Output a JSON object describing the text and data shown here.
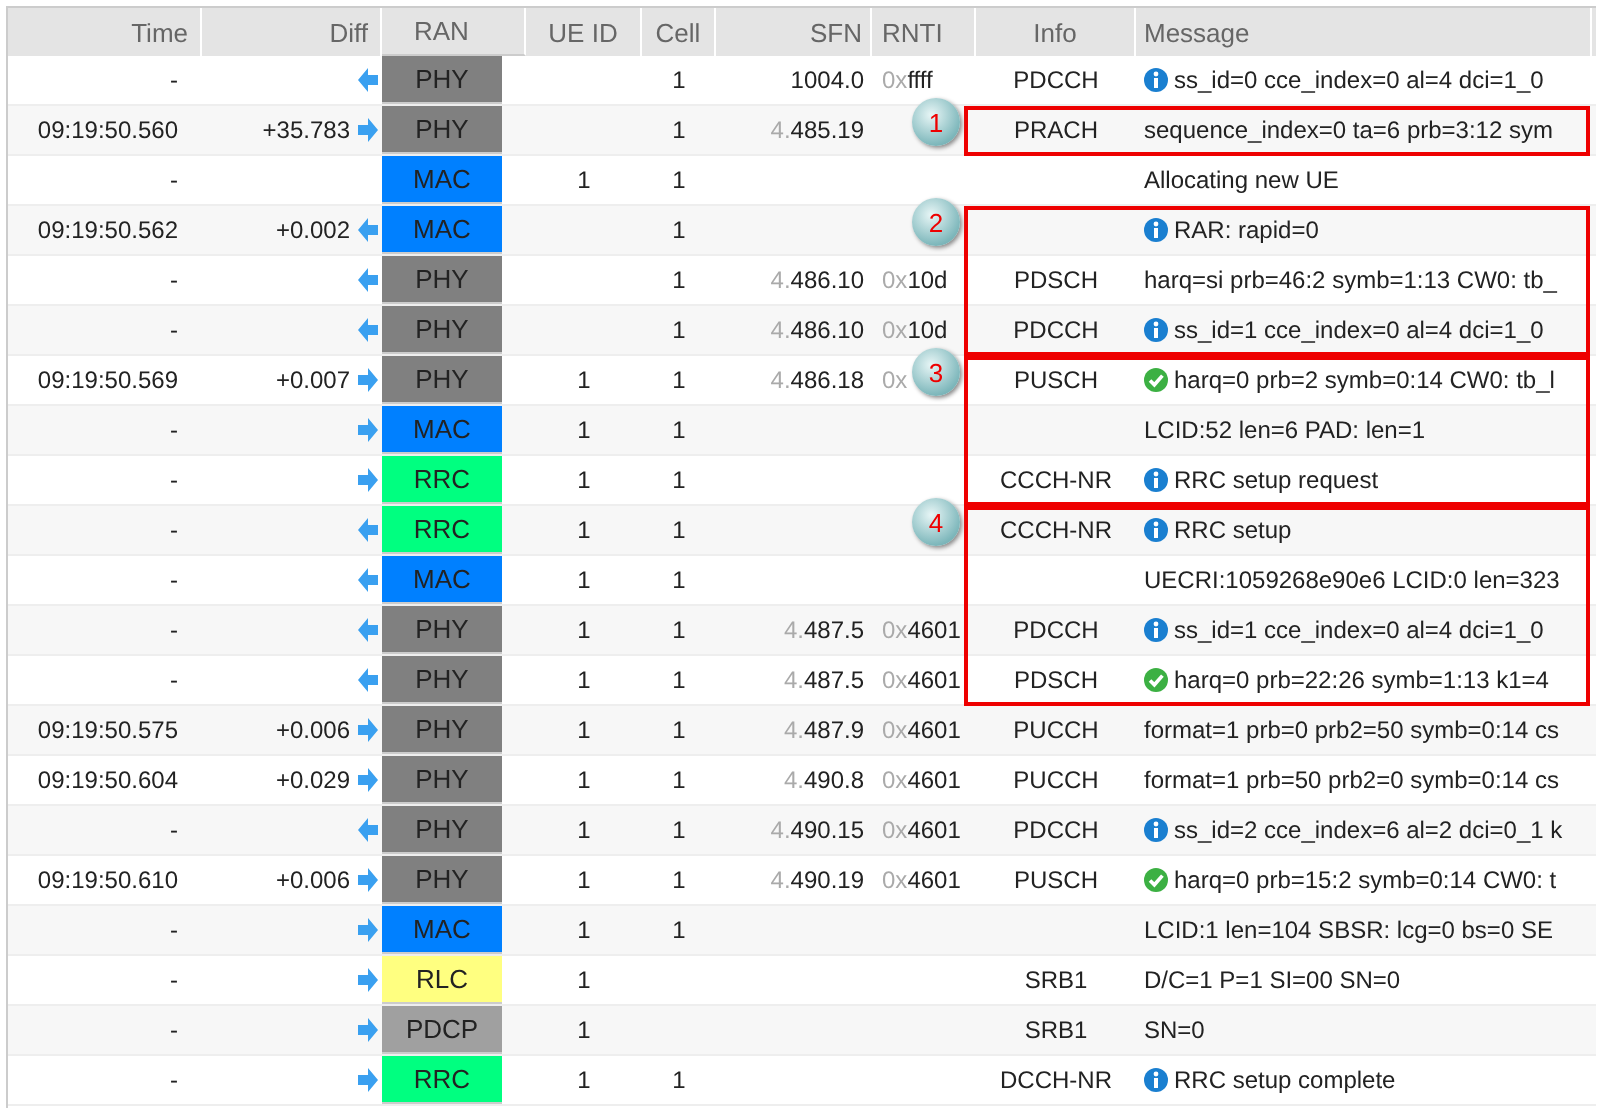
{
  "columns": [
    "Time",
    "Diff",
    "RAN",
    "UE ID",
    "Cell",
    "SFN",
    "RNTI",
    "Info",
    "Message"
  ],
  "rows": [
    {
      "time": "-",
      "diff": "",
      "arrow": true,
      "uplink": false,
      "ran": "PHY",
      "color": "#808080",
      "ue": "",
      "cell": "1",
      "sfn_prefix": "",
      "sfn": "1004.0",
      "rnti_prefix": "0x",
      "rnti": "ffff",
      "info": "PDCCH",
      "kind": "info",
      "message": "ss_id=0 cce_index=0 al=4 dci=1_0",
      "boxed": false
    },
    {
      "time": "09:19:50.560",
      "diff": "+35.783",
      "arrow": true,
      "uplink": true,
      "ran": "PHY",
      "color": "#808080",
      "ue": "",
      "cell": "1",
      "sfn_prefix": "4.",
      "sfn": "485.19",
      "rnti_prefix": "",
      "rnti": "",
      "info": "PRACH",
      "kind": "plain",
      "message": "sequence_index=0 ta=6 prb=3:12 sym",
      "boxed": true,
      "callout": "1"
    },
    {
      "time": "-",
      "diff": "",
      "arrow": false,
      "ran": "MAC",
      "color": "#0080ff",
      "ue": "1",
      "cell": "1",
      "sfn_prefix": "",
      "sfn": "",
      "rnti_prefix": "",
      "rnti": "",
      "info": "",
      "kind": "plain",
      "message": "Allocating new UE",
      "boxed": false
    },
    {
      "time": "09:19:50.562",
      "diff": "+0.002",
      "arrow": true,
      "uplink": false,
      "ran": "MAC",
      "color": "#0080ff",
      "ue": "",
      "cell": "1",
      "sfn_prefix": "",
      "sfn": "",
      "rnti_prefix": "",
      "rnti": "",
      "info": "",
      "kind": "info",
      "message": "RAR: rapid=0",
      "boxed": true,
      "callout": "2"
    },
    {
      "time": "-",
      "diff": "",
      "arrow": true,
      "uplink": false,
      "ran": "PHY",
      "color": "#808080",
      "ue": "",
      "cell": "1",
      "sfn_prefix": "4.",
      "sfn": "486.10",
      "rnti_prefix": "0x",
      "rnti": "10d",
      "info": "PDSCH",
      "kind": "plain",
      "message": "harq=si prb=46:2 symb=1:13 CW0: tb_",
      "boxed": true
    },
    {
      "time": "-",
      "diff": "",
      "arrow": true,
      "uplink": false,
      "ran": "PHY",
      "color": "#808080",
      "ue": "",
      "cell": "1",
      "sfn_prefix": "4.",
      "sfn": "486.10",
      "rnti_prefix": "0x",
      "rnti": "10d",
      "info": "PDCCH",
      "kind": "info",
      "message": "ss_id=1 cce_index=0 al=4 dci=1_0",
      "boxed": true
    },
    {
      "time": "09:19:50.569",
      "diff": "+0.007",
      "arrow": true,
      "uplink": true,
      "ran": "PHY",
      "color": "#808080",
      "ue": "1",
      "cell": "1",
      "sfn_prefix": "4.",
      "sfn": "486.18",
      "rnti_prefix": "0x",
      "rnti": "",
      "info": "PUSCH",
      "kind": "ok",
      "message": "harq=0 prb=2 symb=0:14 CW0: tb_l",
      "boxed": true,
      "callout": "3"
    },
    {
      "time": "-",
      "diff": "",
      "arrow": true,
      "uplink": true,
      "ran": "MAC",
      "color": "#0080ff",
      "ue": "1",
      "cell": "1",
      "sfn_prefix": "",
      "sfn": "",
      "rnti_prefix": "",
      "rnti": "",
      "info": "",
      "kind": "plain",
      "message": "LCID:52 len=6 PAD: len=1",
      "boxed": true
    },
    {
      "time": "-",
      "diff": "",
      "arrow": true,
      "uplink": true,
      "ran": "RRC",
      "color": "#00ff80",
      "ue": "1",
      "cell": "1",
      "sfn_prefix": "",
      "sfn": "",
      "rnti_prefix": "",
      "rnti": "",
      "info": "CCCH-NR",
      "kind": "info",
      "message": "RRC setup request",
      "boxed": true
    },
    {
      "time": "-",
      "diff": "",
      "arrow": true,
      "uplink": false,
      "ran": "RRC",
      "color": "#00ff80",
      "ue": "1",
      "cell": "1",
      "sfn_prefix": "",
      "sfn": "",
      "rnti_prefix": "",
      "rnti": "",
      "info": "CCCH-NR",
      "kind": "info",
      "message": "RRC setup",
      "boxed": true,
      "callout": "4"
    },
    {
      "time": "-",
      "diff": "",
      "arrow": true,
      "uplink": false,
      "ran": "MAC",
      "color": "#0080ff",
      "ue": "1",
      "cell": "1",
      "sfn_prefix": "",
      "sfn": "",
      "rnti_prefix": "",
      "rnti": "",
      "info": "",
      "kind": "plain",
      "message": "UECRI:1059268e90e6 LCID:0 len=323",
      "boxed": true
    },
    {
      "time": "-",
      "diff": "",
      "arrow": true,
      "uplink": false,
      "ran": "PHY",
      "color": "#808080",
      "ue": "1",
      "cell": "1",
      "sfn_prefix": "4.",
      "sfn": "487.5",
      "rnti_prefix": "0x",
      "rnti": "4601",
      "info": "PDCCH",
      "kind": "info",
      "message": "ss_id=1 cce_index=0 al=4 dci=1_0",
      "boxed": true
    },
    {
      "time": "-",
      "diff": "",
      "arrow": true,
      "uplink": false,
      "ran": "PHY",
      "color": "#808080",
      "ue": "1",
      "cell": "1",
      "sfn_prefix": "4.",
      "sfn": "487.5",
      "rnti_prefix": "0x",
      "rnti": "4601",
      "info": "PDSCH",
      "kind": "ok",
      "message": "harq=0 prb=22:26 symb=1:13 k1=4",
      "boxed": true
    },
    {
      "time": "09:19:50.575",
      "diff": "+0.006",
      "arrow": true,
      "uplink": true,
      "ran": "PHY",
      "color": "#808080",
      "ue": "1",
      "cell": "1",
      "sfn_prefix": "4.",
      "sfn": "487.9",
      "rnti_prefix": "0x",
      "rnti": "4601",
      "info": "PUCCH",
      "kind": "plain",
      "message": "format=1 prb=0 prb2=50 symb=0:14 cs",
      "boxed": false
    },
    {
      "time": "09:19:50.604",
      "diff": "+0.029",
      "arrow": true,
      "uplink": true,
      "ran": "PHY",
      "color": "#808080",
      "ue": "1",
      "cell": "1",
      "sfn_prefix": "4.",
      "sfn": "490.8",
      "rnti_prefix": "0x",
      "rnti": "4601",
      "info": "PUCCH",
      "kind": "plain",
      "message": "format=1 prb=50 prb2=0 symb=0:14 cs",
      "boxed": false
    },
    {
      "time": "-",
      "diff": "",
      "arrow": true,
      "uplink": false,
      "ran": "PHY",
      "color": "#808080",
      "ue": "1",
      "cell": "1",
      "sfn_prefix": "4.",
      "sfn": "490.15",
      "rnti_prefix": "0x",
      "rnti": "4601",
      "info": "PDCCH",
      "kind": "info",
      "message": "ss_id=2 cce_index=6 al=2 dci=0_1 k",
      "boxed": false
    },
    {
      "time": "09:19:50.610",
      "diff": "+0.006",
      "arrow": true,
      "uplink": true,
      "ran": "PHY",
      "color": "#808080",
      "ue": "1",
      "cell": "1",
      "sfn_prefix": "4.",
      "sfn": "490.19",
      "rnti_prefix": "0x",
      "rnti": "4601",
      "info": "PUSCH",
      "kind": "ok",
      "message": "harq=0 prb=15:2 symb=0:14 CW0: t",
      "boxed": false
    },
    {
      "time": "-",
      "diff": "",
      "arrow": true,
      "uplink": true,
      "ran": "MAC",
      "color": "#0080ff",
      "ue": "1",
      "cell": "1",
      "sfn_prefix": "",
      "sfn": "",
      "rnti_prefix": "",
      "rnti": "",
      "info": "",
      "kind": "plain",
      "message": "LCID:1 len=104 SBSR: lcg=0 bs=0 SE",
      "boxed": false
    },
    {
      "time": "-",
      "diff": "",
      "arrow": true,
      "uplink": true,
      "ran": "RLC",
      "color": "#ffff80",
      "ue": "1",
      "cell": "",
      "sfn_prefix": "",
      "sfn": "",
      "rnti_prefix": "",
      "rnti": "",
      "info": "SRB1",
      "kind": "plain",
      "message": "D/C=1 P=1 SI=00 SN=0",
      "boxed": false
    },
    {
      "time": "-",
      "diff": "",
      "arrow": true,
      "uplink": true,
      "ran": "PDCP",
      "color": "#a0a0a0",
      "ue": "1",
      "cell": "",
      "sfn_prefix": "",
      "sfn": "",
      "rnti_prefix": "",
      "rnti": "",
      "info": "SRB1",
      "kind": "plain",
      "message": "SN=0",
      "boxed": false
    },
    {
      "time": "-",
      "diff": "",
      "arrow": true,
      "uplink": true,
      "ran": "RRC",
      "color": "#00ff80",
      "ue": "1",
      "cell": "1",
      "sfn_prefix": "",
      "sfn": "",
      "rnti_prefix": "",
      "rnti": "",
      "info": "DCCH-NR",
      "kind": "info",
      "message": "RRC setup complete",
      "boxed": false
    }
  ]
}
